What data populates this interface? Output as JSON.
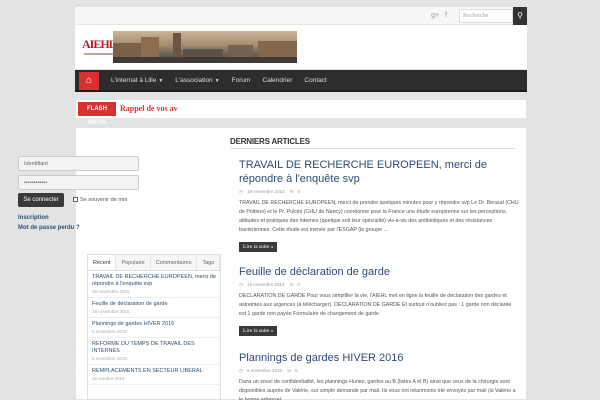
{
  "search": {
    "placeholder": "Recherche",
    "button": "⚲"
  },
  "social": [
    "g+",
    "f"
  ],
  "logo": {
    "text": "AIEHL"
  },
  "nav": {
    "home": "⌂",
    "items": [
      {
        "label": "L'internat à Lille",
        "dropdown": true
      },
      {
        "label": "L'association",
        "dropdown": true
      },
      {
        "label": "Forum",
        "dropdown": false
      },
      {
        "label": "Calendrier",
        "dropdown": false
      },
      {
        "label": "Contact",
        "dropdown": false
      }
    ]
  },
  "flash": {
    "label": "FLASH INFOS",
    "text": "Rappel de vos av"
  },
  "login": {
    "username_placeholder": "Identifiant",
    "password_value": "••••••••••••",
    "login_button": "Se connecter",
    "remember": "Se souvenir de moi",
    "register": "Inscription",
    "forgot": "Mot de passe perdu ?"
  },
  "tabs": {
    "labels": [
      "Récent",
      "Populaire",
      "Commentaires",
      "Tags"
    ],
    "items": [
      {
        "title": "TRAVAIL DE RECHERCHE EUROPEEN, merci de répondre à l'enquête svp",
        "date": "19 novembre 2015"
      },
      {
        "title": "Feuille de déclaration de garde",
        "date": "19 novembre 2015"
      },
      {
        "title": "Plannings de gardes HIVER 2016",
        "date": "5 novembre 2015"
      },
      {
        "title": "REFORME DU TEMPS DE TRAVAIL DES INTERNES",
        "date": "3 novembre 2015"
      },
      {
        "title": "REMPLACEMENTS EN SECTEUR LIBERAL",
        "date": "16 octobre 2015"
      }
    ]
  },
  "main": {
    "section_title": "Derniers articles",
    "articles": [
      {
        "title": "TRAVAIL DE RECHERCHE EUROPEEN, merci de répondre à l'enquête svp",
        "date": "19 novembre 2015",
        "comments": "0",
        "excerpt": "TRAVAIL DE RECHERCHE EUROPEEN, merci de prendre quelques minutes pour y répondre svp Le Dr. Béraud (CHU de Poitiers) et le Pr. Pulcini (CHU de Nancy) coordonne pour la France une étude européenne sur les perceptions, attitudes et pratiques des internes (quelque soit leur spécialité) vis-à-vis des antibiotiques et des résistances bactériennes. Cette étude est menée par l'ESGAP (le groupe ...",
        "more": "Lire la suite »"
      },
      {
        "title": "Feuille de déclaration de garde",
        "date": "19 novembre 2015",
        "comments": "0",
        "excerpt": "DECLARATION DE GARDE Pour vous simplifier la vie, l'AIEHL met en ligne la feuille de déclaration des gardes et astreintes aux urgences (à télécharger). DECLARATION DE GARDE Et surtout n'oubliez pas : 1 garde non déclarée est 1 garde non payée Formulaire de changement de garde",
        "more": "Lire la suite »"
      },
      {
        "title": "Plannings de gardes HIVER 2016",
        "date": "5 novembre 2015",
        "comments": "6",
        "excerpt": "Dans un souci de confidentialité, les plannings Huriez, gardes au B (listes A et B) ainsi que ceux de la chirurgie sont disponibles auprès de Valérie, sur simple demande par mail. Ils vous ont néanmoins été envoyés par mail (si Valérie a le bonne adresse).",
        "more": ""
      }
    ]
  }
}
